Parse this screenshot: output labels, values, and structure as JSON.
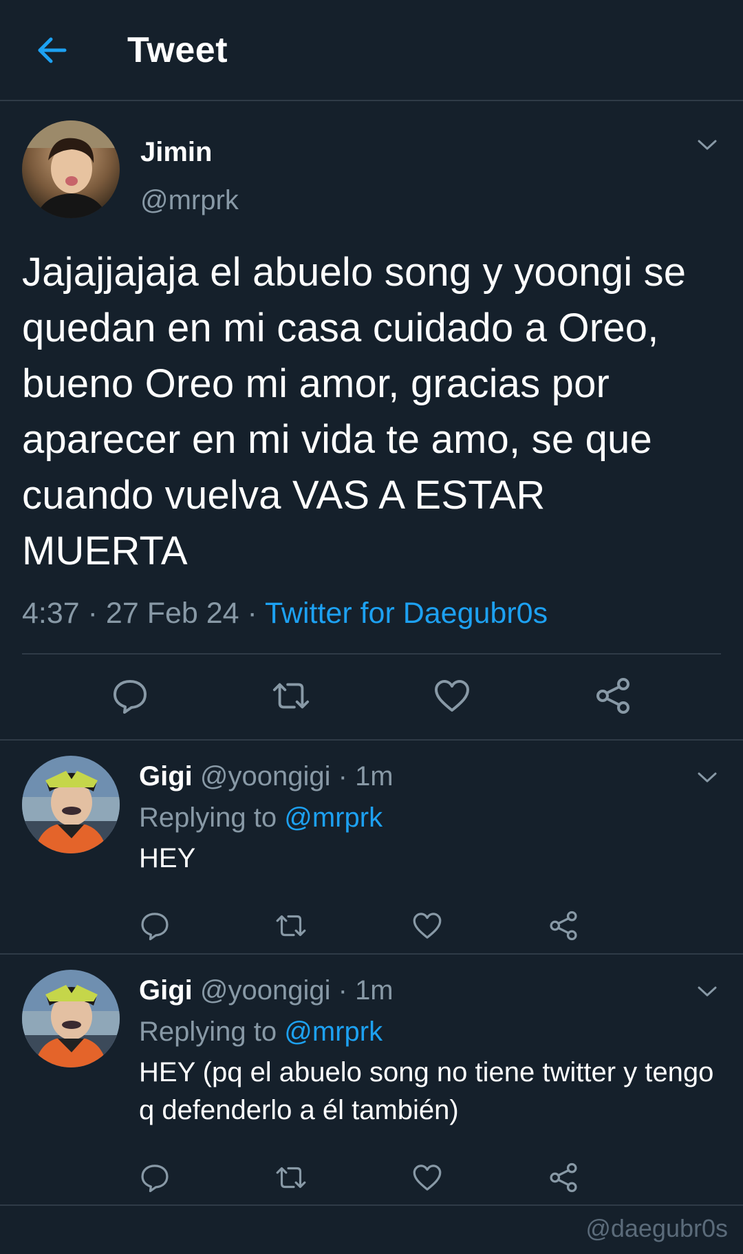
{
  "header": {
    "title": "Tweet",
    "back_icon": "arrow-left-icon"
  },
  "main_tweet": {
    "author_name": "Jimin",
    "author_handle": "@mrprk",
    "text": "Jajajjajaja el abuelo song y yoongi se quedan en mi casa cuidado a Oreo, bueno Oreo mi amor, gracias por aparecer en mi vida te amo, se que cuando vuelva VAS A ESTAR MUERTA",
    "time": "4:37",
    "date": "27 Feb 24",
    "source": "Twitter for Daegubr0s",
    "separator": " · "
  },
  "replies": [
    {
      "name": "Gigi",
      "handle": "@yoongigi",
      "time": "1m",
      "replying_label": "Replying to",
      "replying_to": "@mrprk",
      "text": "HEY"
    },
    {
      "name": "Gigi",
      "handle": "@yoongigi",
      "time": "1m",
      "replying_label": "Replying to",
      "replying_to": "@mrprk",
      "text": "HEY (pq el abuelo song no tiene twitter y tengo q defenderlo a él también)"
    }
  ],
  "watermark": "@daegubr0s",
  "colors": {
    "background": "#15202b",
    "accent": "#1da1f2",
    "muted": "#8899a6",
    "divider": "#2f3b47"
  }
}
